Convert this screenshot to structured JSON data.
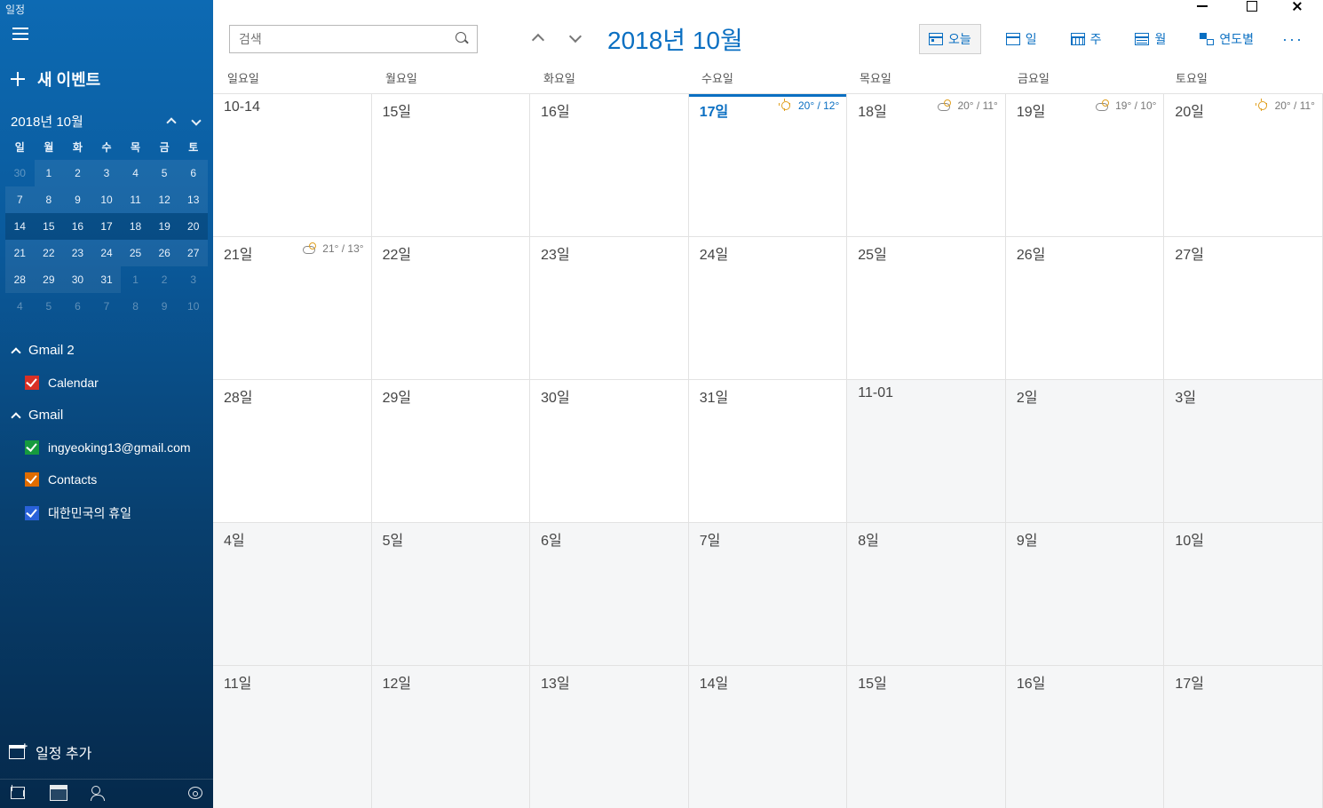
{
  "app_title_fragment": "일정",
  "sidebar": {
    "new_event": "새 이벤트",
    "mini_cal_title": "2018년 10월",
    "dow": [
      "일",
      "월",
      "화",
      "수",
      "목",
      "금",
      "토"
    ],
    "mini_days": [
      {
        "n": "30",
        "dim": true
      },
      {
        "n": "1",
        "cur": true
      },
      {
        "n": "2",
        "cur": true
      },
      {
        "n": "3",
        "cur": true
      },
      {
        "n": "4",
        "cur": true
      },
      {
        "n": "5",
        "cur": true
      },
      {
        "n": "6",
        "cur": true
      },
      {
        "n": "7",
        "cur": true
      },
      {
        "n": "8",
        "cur": true
      },
      {
        "n": "9",
        "cur": true
      },
      {
        "n": "10",
        "cur": true
      },
      {
        "n": "11",
        "cur": true
      },
      {
        "n": "12",
        "cur": true
      },
      {
        "n": "13",
        "cur": true
      },
      {
        "n": "14",
        "cur": true,
        "hl": true
      },
      {
        "n": "15",
        "cur": true,
        "hl": true
      },
      {
        "n": "16",
        "cur": true,
        "hl": true
      },
      {
        "n": "17",
        "cur": true,
        "today": true,
        "hl": true
      },
      {
        "n": "18",
        "cur": true,
        "hl": true
      },
      {
        "n": "19",
        "cur": true,
        "hl": true
      },
      {
        "n": "20",
        "cur": true,
        "hl": true
      },
      {
        "n": "21",
        "cur": true
      },
      {
        "n": "22",
        "cur": true
      },
      {
        "n": "23",
        "cur": true
      },
      {
        "n": "24",
        "cur": true
      },
      {
        "n": "25",
        "cur": true
      },
      {
        "n": "26",
        "cur": true
      },
      {
        "n": "27",
        "cur": true
      },
      {
        "n": "28",
        "cur": true
      },
      {
        "n": "29",
        "cur": true
      },
      {
        "n": "30",
        "cur": true
      },
      {
        "n": "31",
        "cur": true
      },
      {
        "n": "1",
        "dim": true
      },
      {
        "n": "2",
        "dim": true
      },
      {
        "n": "3",
        "dim": true
      },
      {
        "n": "4",
        "dim": true
      },
      {
        "n": "5",
        "dim": true
      },
      {
        "n": "6",
        "dim": true
      },
      {
        "n": "7",
        "dim": true
      },
      {
        "n": "8",
        "dim": true
      },
      {
        "n": "9",
        "dim": true
      },
      {
        "n": "10",
        "dim": true
      }
    ],
    "accounts": [
      {
        "name": "Gmail 2",
        "items": [
          {
            "label": "Calendar",
            "color": "red"
          }
        ]
      },
      {
        "name": "Gmail",
        "items": [
          {
            "label": "ingyeoking13@gmail.com",
            "color": "green"
          },
          {
            "label": "Contacts",
            "color": "orange"
          },
          {
            "label": "대한민국의 휴일",
            "color": "blue"
          }
        ]
      }
    ],
    "add_calendar": "일정 추가"
  },
  "toolbar": {
    "search_placeholder": "검색",
    "month_title": "2018년 10월",
    "views": {
      "today": "오늘",
      "day": "일",
      "week": "주",
      "month": "월",
      "year": "연도별"
    }
  },
  "dow_full": [
    "일요일",
    "월요일",
    "화요일",
    "수요일",
    "목요일",
    "금요일",
    "토요일"
  ],
  "grid": [
    {
      "label": "10-14"
    },
    {
      "label": "15일"
    },
    {
      "label": "16일"
    },
    {
      "label": "17일",
      "today": true,
      "weather": {
        "icon": "sun",
        "text": "20° / 12°"
      }
    },
    {
      "label": "18일",
      "weather": {
        "icon": "pc",
        "text": "20° / 11°"
      }
    },
    {
      "label": "19일",
      "weather": {
        "icon": "pc",
        "text": "19° / 10°"
      }
    },
    {
      "label": "20일",
      "weather": {
        "icon": "sun",
        "text": "20° / 11°"
      }
    },
    {
      "label": "21일",
      "weather": {
        "icon": "pc",
        "text": "21° / 13°"
      }
    },
    {
      "label": "22일"
    },
    {
      "label": "23일"
    },
    {
      "label": "24일"
    },
    {
      "label": "25일"
    },
    {
      "label": "26일"
    },
    {
      "label": "27일"
    },
    {
      "label": "28일"
    },
    {
      "label": "29일"
    },
    {
      "label": "30일"
    },
    {
      "label": "31일"
    },
    {
      "label": "11-01",
      "dim": true
    },
    {
      "label": "2일",
      "dim": true
    },
    {
      "label": "3일",
      "dim": true
    },
    {
      "label": "4일",
      "dim": true
    },
    {
      "label": "5일",
      "dim": true
    },
    {
      "label": "6일",
      "dim": true
    },
    {
      "label": "7일",
      "dim": true
    },
    {
      "label": "8일",
      "dim": true
    },
    {
      "label": "9일",
      "dim": true
    },
    {
      "label": "10일",
      "dim": true
    },
    {
      "label": "11일",
      "dim": true
    },
    {
      "label": "12일",
      "dim": true
    },
    {
      "label": "13일",
      "dim": true
    },
    {
      "label": "14일",
      "dim": true
    },
    {
      "label": "15일",
      "dim": true
    },
    {
      "label": "16일",
      "dim": true
    },
    {
      "label": "17일",
      "dim": true
    }
  ]
}
